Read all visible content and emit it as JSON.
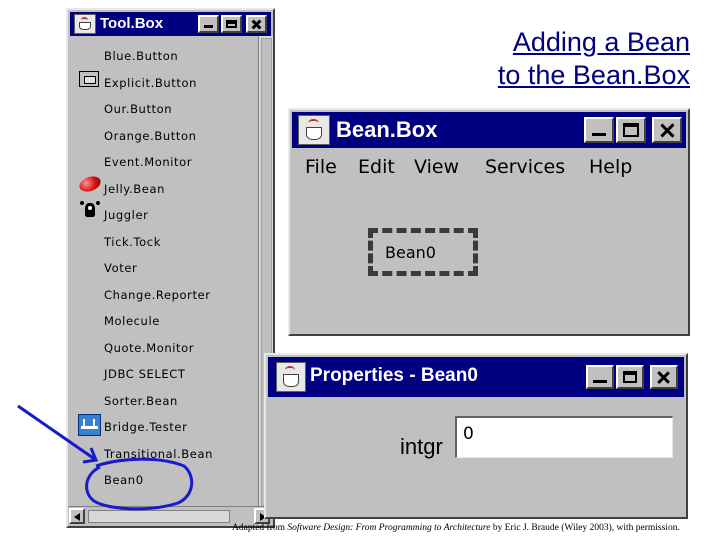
{
  "slide": {
    "title_line1": "Adding a Bean",
    "title_line2": "to the Bean.Box",
    "credit_prefix": "Adapted from ",
    "credit_book": "Software Design: From Programming to Architecture",
    "credit_suffix": " by Eric J. Braude (Wiley 2003), with permission."
  },
  "toolbox": {
    "title": "Tool.Box",
    "items": [
      {
        "label": "Blue.Button",
        "icon": ""
      },
      {
        "label": "Explicit.Button",
        "icon": "button-icon"
      },
      {
        "label": "Our.Button",
        "icon": ""
      },
      {
        "label": "Orange.Button",
        "icon": ""
      },
      {
        "label": "Event.Monitor",
        "icon": ""
      },
      {
        "label": "Jelly.Bean",
        "icon": "jellybean-icon"
      },
      {
        "label": "Juggler",
        "icon": "juggler-icon"
      },
      {
        "label": "Tick.Tock",
        "icon": ""
      },
      {
        "label": "Voter",
        "icon": ""
      },
      {
        "label": "Change.Reporter",
        "icon": ""
      },
      {
        "label": "Molecule",
        "icon": ""
      },
      {
        "label": "Quote.Monitor",
        "icon": ""
      },
      {
        "label": "JDBC SELECT",
        "icon": ""
      },
      {
        "label": "Sorter.Bean",
        "icon": ""
      },
      {
        "label": "Bridge.Tester",
        "icon": "bridge-icon"
      },
      {
        "label": "Transitional.Bean",
        "icon": ""
      },
      {
        "label": "Bean0",
        "icon": ""
      }
    ]
  },
  "beanbox": {
    "title": "Bean.Box",
    "menu": [
      "File",
      "Edit",
      "View",
      "Services",
      "Help"
    ],
    "bean_label": "Bean0"
  },
  "properties": {
    "title": "Properties - Bean0",
    "field_label": "intgr",
    "field_value": "0"
  },
  "colors": {
    "titlebar": "#000080",
    "window": "#c0c0c0",
    "annotation": "#1a1acc",
    "slide_title": "#000080"
  }
}
